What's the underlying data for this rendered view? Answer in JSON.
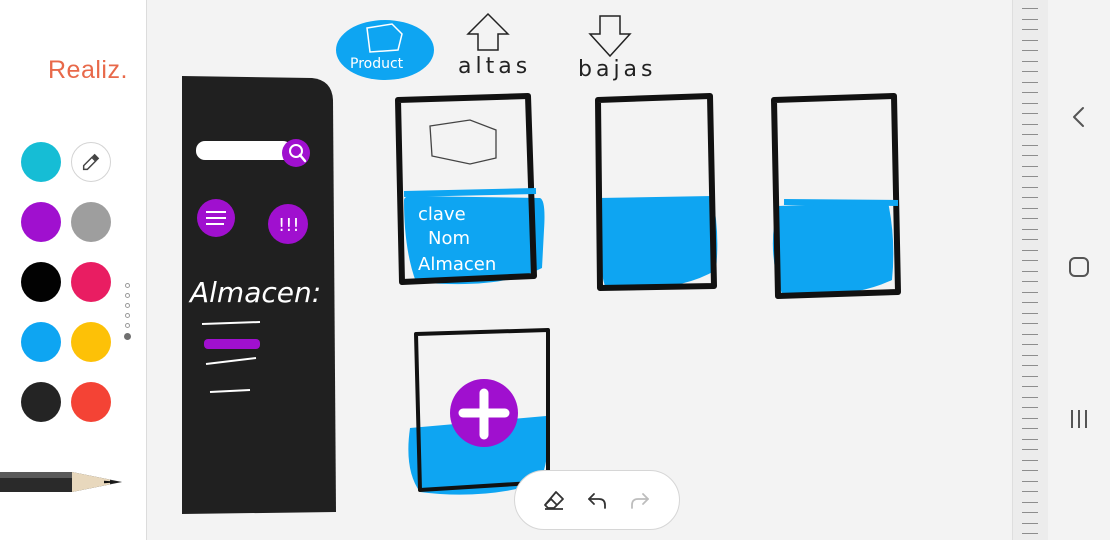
{
  "app": {
    "done_label": "Realiz."
  },
  "palette": {
    "colors": [
      {
        "name": "cyan",
        "hex": "#16bdd5"
      },
      {
        "name": "purple",
        "hex": "#a010cf"
      },
      {
        "name": "gray",
        "hex": "#9e9e9e"
      },
      {
        "name": "black",
        "hex": "#020202"
      },
      {
        "name": "pink",
        "hex": "#e91d62"
      },
      {
        "name": "blue",
        "hex": "#0ea5f2"
      },
      {
        "name": "amber",
        "hex": "#fdc107"
      },
      {
        "name": "charcoal",
        "hex": "#242424"
      },
      {
        "name": "red",
        "hex": "#f44335"
      }
    ],
    "eyedropper_icon": "eyedropper-icon",
    "pages": {
      "count": 6,
      "active": 6
    }
  },
  "sketch": {
    "labels": {
      "product": "Product",
      "altas": "altas",
      "bajas": "bajas",
      "almacen": "Almacen:",
      "card_line1": "clave",
      "card_line2": "Nom",
      "card_line3": "Almacen"
    },
    "colors": {
      "ink": "#111111",
      "blue": "#0ea5f2",
      "purple": "#a010cf",
      "sidebar": "#202020",
      "white": "#ffffff"
    }
  },
  "toolbar": {
    "eraser_icon": "eraser-icon",
    "undo_icon": "undo-icon",
    "redo_icon": "redo-icon",
    "redo_enabled": false
  },
  "navbar": {
    "back_icon": "back-chevron-icon",
    "home_icon": "home-square-icon",
    "recents_icon": "recents-bars-icon"
  }
}
